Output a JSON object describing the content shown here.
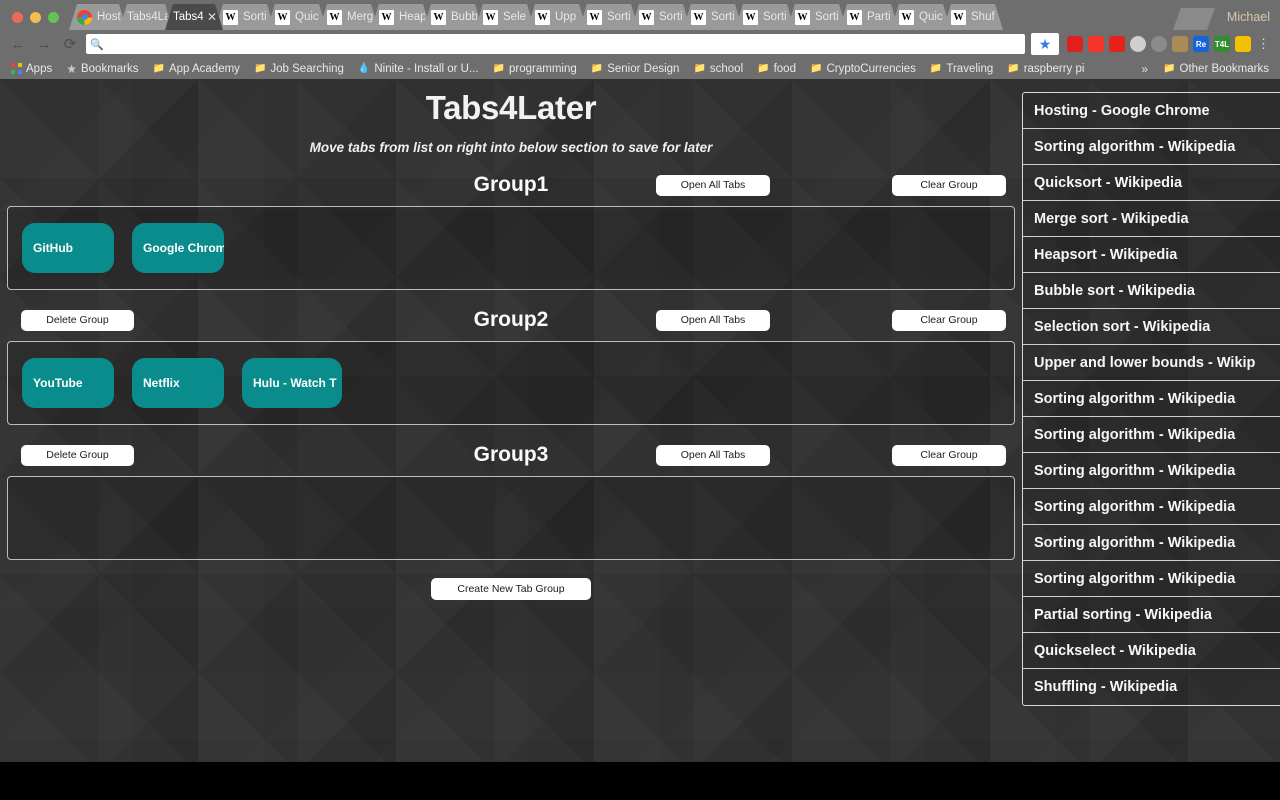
{
  "window": {
    "profile_name": "Michael",
    "controls": [
      "close",
      "minimize",
      "maximize"
    ]
  },
  "tabs": [
    {
      "title": "Host",
      "favicon": "chrome-icon",
      "active": false
    },
    {
      "title": "Tabs4La",
      "favicon": "t4l-icon",
      "active": false
    },
    {
      "title": "Tabs4",
      "favicon": "none",
      "active": true,
      "closable": true
    },
    {
      "title": "Sorti",
      "favicon": "wikipedia-icon",
      "active": false
    },
    {
      "title": "Quic",
      "favicon": "wikipedia-icon",
      "active": false
    },
    {
      "title": "Merg",
      "favicon": "wikipedia-icon",
      "active": false
    },
    {
      "title": "Heap",
      "favicon": "wikipedia-icon",
      "active": false
    },
    {
      "title": "Bubb",
      "favicon": "wikipedia-icon",
      "active": false
    },
    {
      "title": "Sele",
      "favicon": "wikipedia-icon",
      "active": false
    },
    {
      "title": "Upp",
      "favicon": "wikipedia-icon",
      "active": false
    },
    {
      "title": "Sorti",
      "favicon": "wikipedia-icon",
      "active": false
    },
    {
      "title": "Sorti",
      "favicon": "wikipedia-icon",
      "active": false
    },
    {
      "title": "Sorti",
      "favicon": "wikipedia-icon",
      "active": false
    },
    {
      "title": "Sorti",
      "favicon": "wikipedia-icon",
      "active": false
    },
    {
      "title": "Sorti",
      "favicon": "wikipedia-icon",
      "active": false
    },
    {
      "title": "Parti",
      "favicon": "wikipedia-icon",
      "active": false
    },
    {
      "title": "Quic",
      "favicon": "wikipedia-icon",
      "active": false
    },
    {
      "title": "Shuf",
      "favicon": "wikipedia-icon",
      "active": false
    }
  ],
  "toolbar": {
    "back_icon": "arrow-left-icon",
    "forward_icon": "arrow-right-icon",
    "reload_icon": "reload-icon",
    "omnibox_value": "",
    "omnibox_placeholder": "",
    "search_icon": "search-icon",
    "bookmark_star_icon": "star-icon",
    "menu_icon": "three-dots-icon",
    "extensions": [
      {
        "name": "adblock-extension",
        "glyph": "",
        "color": "#e02020"
      },
      {
        "name": "honey-extension",
        "glyph": "",
        "color": "#f5342a"
      },
      {
        "name": "youtube-extension",
        "glyph": "",
        "color": "#e62117"
      },
      {
        "name": "moon-reader-extension",
        "glyph": "",
        "color": "#cfcfcf"
      },
      {
        "name": "ghost-extension",
        "glyph": "",
        "color": "#8a8a8a"
      },
      {
        "name": "avatar-extension",
        "glyph": "",
        "color": "#a98b55"
      },
      {
        "name": "reddit-enhancement-extension",
        "glyph": "Re",
        "color": "#1565d8"
      },
      {
        "name": "tabs4later-extension",
        "glyph": "T4L",
        "color": "#2f8f2f"
      },
      {
        "name": "duckduckgo-extension",
        "glyph": "",
        "color": "#f2c200"
      }
    ]
  },
  "bookmarks_bar": {
    "items": [
      {
        "label": "Apps",
        "icon": "apps-grid-icon"
      },
      {
        "label": "Bookmarks",
        "icon": "star-icon"
      },
      {
        "label": "App Academy",
        "icon": "folder-icon"
      },
      {
        "label": "Job Searching",
        "icon": "folder-icon"
      },
      {
        "label": "Ninite - Install or U...",
        "icon": "ninite-icon"
      },
      {
        "label": "programming",
        "icon": "folder-icon"
      },
      {
        "label": "Senior Design",
        "icon": "folder-icon"
      },
      {
        "label": "school",
        "icon": "folder-icon"
      },
      {
        "label": "food",
        "icon": "folder-icon"
      },
      {
        "label": "CryptoCurrencies",
        "icon": "folder-icon"
      },
      {
        "label": "Traveling",
        "icon": "folder-icon"
      },
      {
        "label": "raspberry pi",
        "icon": "folder-icon"
      }
    ],
    "overflow_icon": "double-chevron-icon",
    "other_bookmarks": {
      "label": "Other Bookmarks",
      "icon": "folder-icon"
    }
  },
  "app": {
    "title": "Tabs4Later",
    "subtitle": "Move tabs from list on right into below section to save for later",
    "create_button": "Create New Tab Group",
    "accent_color": "#0a8c8c",
    "background_color": "#2e2e2e",
    "groups": [
      {
        "name": "Group1",
        "has_delete": false,
        "delete_label": "Delete Group",
        "open_label": "Open All Tabs",
        "clear_label": "Clear Group",
        "tabs": [
          "GitHub",
          "Google Chrome"
        ]
      },
      {
        "name": "Group2",
        "has_delete": true,
        "delete_label": "Delete Group",
        "open_label": "Open All Tabs",
        "clear_label": "Clear Group",
        "tabs": [
          "YouTube",
          "Netflix",
          "Hulu - Watch T"
        ]
      },
      {
        "name": "Group3",
        "has_delete": true,
        "delete_label": "Delete Group",
        "open_label": "Open All Tabs",
        "clear_label": "Clear Group",
        "tabs": []
      }
    ],
    "open_tabs_list": [
      "Hosting - Google Chrome",
      "Sorting algorithm - Wikipedia",
      "Quicksort - Wikipedia",
      "Merge sort - Wikipedia",
      "Heapsort - Wikipedia",
      "Bubble sort - Wikipedia",
      "Selection sort - Wikipedia",
      "Upper and lower bounds - Wikip",
      "Sorting algorithm - Wikipedia",
      "Sorting algorithm - Wikipedia",
      "Sorting algorithm - Wikipedia",
      "Sorting algorithm - Wikipedia",
      "Sorting algorithm - Wikipedia",
      "Sorting algorithm - Wikipedia",
      "Partial sorting - Wikipedia",
      "Quickselect - Wikipedia",
      "Shuffling - Wikipedia"
    ]
  }
}
